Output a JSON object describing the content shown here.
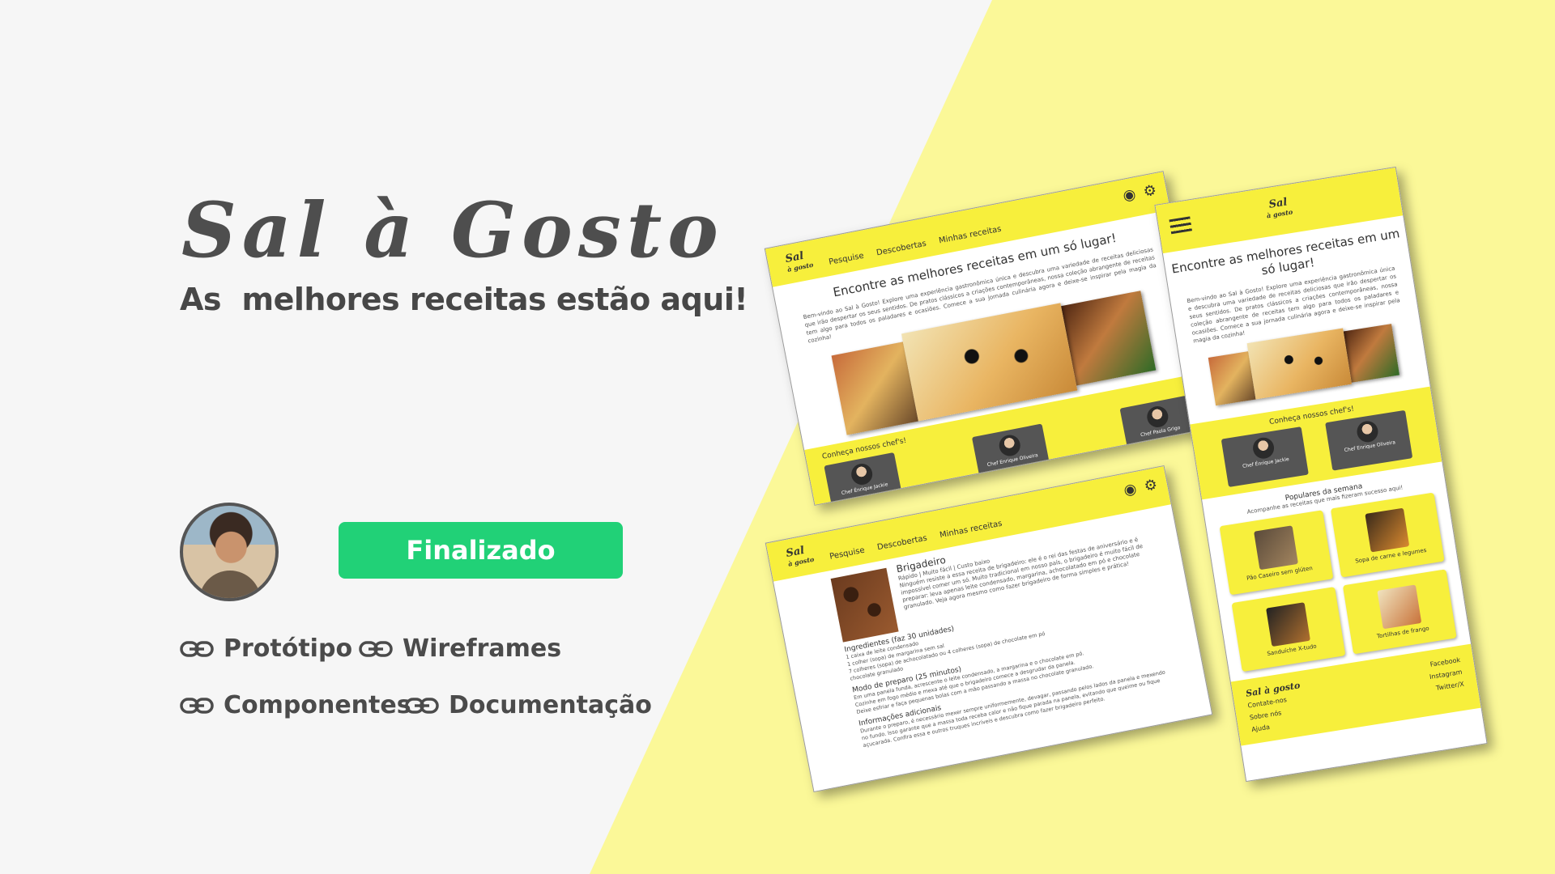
{
  "project": {
    "title": "Sal à Gosto",
    "tagline": "As  melhores receitas estão aqui!",
    "status": "Finalizado"
  },
  "links": [
    {
      "label": "Protótipo",
      "icon": "link-icon"
    },
    {
      "label": "Wireframes",
      "icon": "link-icon"
    },
    {
      "label": "Componentes",
      "icon": "link-icon"
    },
    {
      "label": "Documentação",
      "icon": "link-icon"
    }
  ],
  "colors": {
    "background": "#f6f6f6",
    "accent_yellow": "#fbf898",
    "mockup_yellow": "#f7ef3c",
    "status_green": "#21d177",
    "text_dark": "#474747"
  },
  "mockups": {
    "logo_main": "Sal",
    "logo_sub": "à gosto",
    "nav": [
      "Pesquise",
      "Descobertas",
      "Minhas receitas"
    ],
    "hero_heading": "Encontre as melhores receitas em um só lugar!",
    "hero_text": "Bem-vindo ao Sal à Gosto! Explore uma experiência gastronômica única e descubra uma variedade de receitas deliciosas que irão despertar os seus sentidos. De pratos clássicos a criações contemporâneas, nossa coleção abrangente de receitas tem algo para todos os paladares e ocasiões. Comece a sua jornada culinária agora e deixe-se inspirar pela magia da cozinha!",
    "chefs_label": "Conheça nossos chef's!",
    "chefs": [
      "Chef Énrique Jackie",
      "Chef Enrique Oliveira",
      "Chef Paola Grigo"
    ],
    "recipe": {
      "title": "Brigadeiro",
      "meta": "Rápido | Muito fácil | Custo baixo",
      "intro": "Ninguém resiste a essa receita de brigadeiro: ele é o rei das festas de aniversário e é impossível comer um só. Muito tradicional em nosso país, o brigadeiro é muito fácil de preparar: leva apenas leite condensado, margarina, achocolatado em pó e chocolate granulado. Veja agora mesmo como fazer brigadeiro de forma simples e prática!",
      "ingredients_title": "Ingredientes (faz 30 unidades)",
      "ingredients": [
        "1 caixa de leite condensado",
        "1 colher (sopa) de margarina sem sal",
        "7 colheres (sopa) de achocolatado ou 4 colheres (sopa) de chocolate em pó",
        "chocolate granulado"
      ],
      "steps_title": "Modo de preparo (25 minutos)",
      "steps": [
        "Em uma panela funda, acrescente o leite condensado, a margarina e o chocolate em pó.",
        "Cozinhe em fogo médio e mexa até que o brigadeiro comece a desgrudar da panela.",
        "Deixe esfriar e faça pequenas bolas com a mão passando a massa no chocolate granulado."
      ],
      "info_title": "Informações adicionais",
      "info": "Durante o preparo, é necessário mexer sempre uniformemente, devagar, passando pelos lados da panela e mexendo no fundo. Isso garante que a massa toda receba calor e não fique parada na panela, evitando que queime ou fique açucarada. Confira essa e outros truques incríveis e descubra como fazer brigadeiro perfeito."
    },
    "popular_title": "Populares da semana",
    "popular_subtitle": "Acompanhe as receitas que mais fizeram sucesso aqui!",
    "popular": [
      "Pão Caseiro sem glúten",
      "Sopa de carne e legumes",
      "Sanduíche X-tudo",
      "Tortilhas de frango"
    ],
    "footer_logo": "Sal à gosto",
    "footer_left": [
      "Contate-nos",
      "Sobre nós",
      "Ajuda"
    ],
    "footer_right": [
      "Facebook",
      "Instagram",
      "Twitter/X"
    ]
  }
}
